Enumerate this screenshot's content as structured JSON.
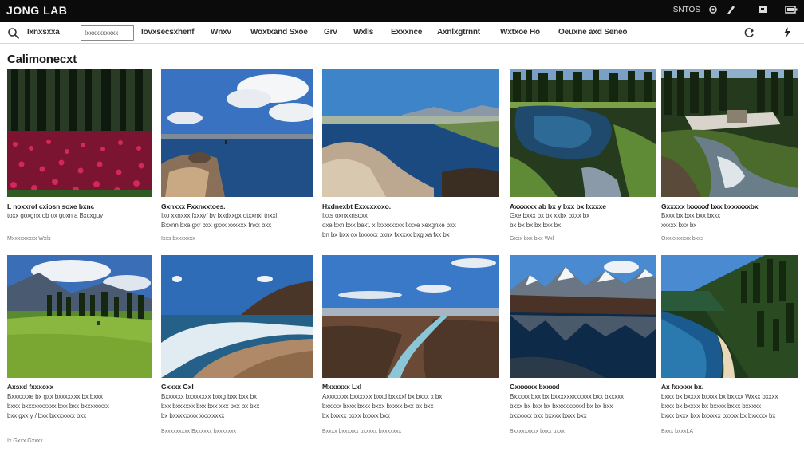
{
  "app": {
    "title": "JONG LAB"
  },
  "system": {
    "status_text": "SNTOS",
    "icons": [
      "settings-icon",
      "pen-icon",
      "user-icon",
      "battery-icon"
    ]
  },
  "nav": {
    "brand": "Ixnxsxxa",
    "search_value": "Ixxxxxxxxxx",
    "links": [
      "Iovxsecsxhenf",
      "Wnxv",
      "Woxtxand Sxoe",
      "Grv",
      "Wxlls",
      "Exxxnce",
      "Axnlxgtrnnt",
      "Wxtxoe Ho",
      "Oeuxne axd Seneo"
    ]
  },
  "page": {
    "heading": "Calimonecxt"
  },
  "cards": [
    {
      "title": "L noxxrof cxiosn soxe bxnc",
      "desc": "toxx goxgnx ob ox goxn a Bxcxguy",
      "meta": "Mxxxxxxxxx Wxls"
    },
    {
      "title": "Gxnxxx Fxxnxxtoes.",
      "desc": "Ixo xxnxxx fxxxyf bv lxxdxxgx otxxnxl tnxxl\nBxxnn bxe gxr bxx gxxx xxxxxx fnxx bxx",
      "meta": "Ixxs bxxxxxxx"
    },
    {
      "title": "Hxdnexbt Exxcxxoxo.",
      "desc": "Ixxs oxnxxnsoxx\noxe bxn bxx bext. x Ixxxxxxxx Ixxxe xexgnxe bxx\nbn bx bxx ox bxxxxx bxnx fxxxxx bxg xa fxx bx",
      "meta": ""
    },
    {
      "title": "Axxxxxx ab bx y bxx bx lxxxxe",
      "desc": "Gxe bxxx bx bx xxbx bxxx bx\nbx bx bx bx bxx bx",
      "meta": "Gxxx bxx bxx Wxl"
    },
    {
      "title": "Gxxxxx lxxxxxf bxx bxxxxxxbx",
      "desc": "Bxxx bx bxx bxx bxxx\nxxxxx bxx bx",
      "meta": "Oxxxxxxxxx bxxs"
    },
    {
      "title": "Axsxd fxxxoxx",
      "desc": "Bxxxxxxe bx gxx bxxxxxxx bx bxxx\nbxxx bxxxxxxxxxx bxx bxx bxxxxxxxx\nbxx gxx y / bxx bxxxxxxx bxx",
      "meta": "Ix Gxxx Gxxxx"
    },
    {
      "title": "Gxxxx Gxl",
      "desc": "Bxxxxxx bxxxxxxx bxxg bxx bxx bx\nbxx bxxxxxx bxx bxx xxx bxx bx bxx\nbx bxxxxxxxx xxxxxxxx",
      "meta": "Bxxxxxxxxx Bxxxxxx bxxxxxxx"
    },
    {
      "title": "Mxxxxxx Lxl",
      "desc": "Axxxxxxx bxxxxxx bxxd bxxxxf bx bxxx x bx\nbxxxxx bxxx bxxx bxxx bxxxx bxx bx bxx\nbx bxxxx bxxx bxxxx bxx",
      "meta": "Bxxxx bxxxxxx bxxxxx bxxxxxxx"
    },
    {
      "title": "Gxxxxxx bxxxxl",
      "desc": "Bxxxxx bxx bx bxxxxxxxxxxxx bxx bxxxxx\nbxxx bx bxx bx bxxxxxxxxxl bx bx bxx\nbxxxxxx bxx bxxxx bxxx bxx",
      "meta": "Bxxxxxxxxx bxxx bxxx"
    },
    {
      "title": "Ax fxxxxx bx.",
      "desc": "bxxx bx bxxxx bxxxx bx bxxxx Wxxx bxxxx\nbxxx bx bxxxx bx bxxxx bxxx bxxxxx\nbxxx bxxx bxx bxxxxx bxxxx bx bxxxxx bx",
      "meta": "Bxxx bxxxLA"
    }
  ]
}
